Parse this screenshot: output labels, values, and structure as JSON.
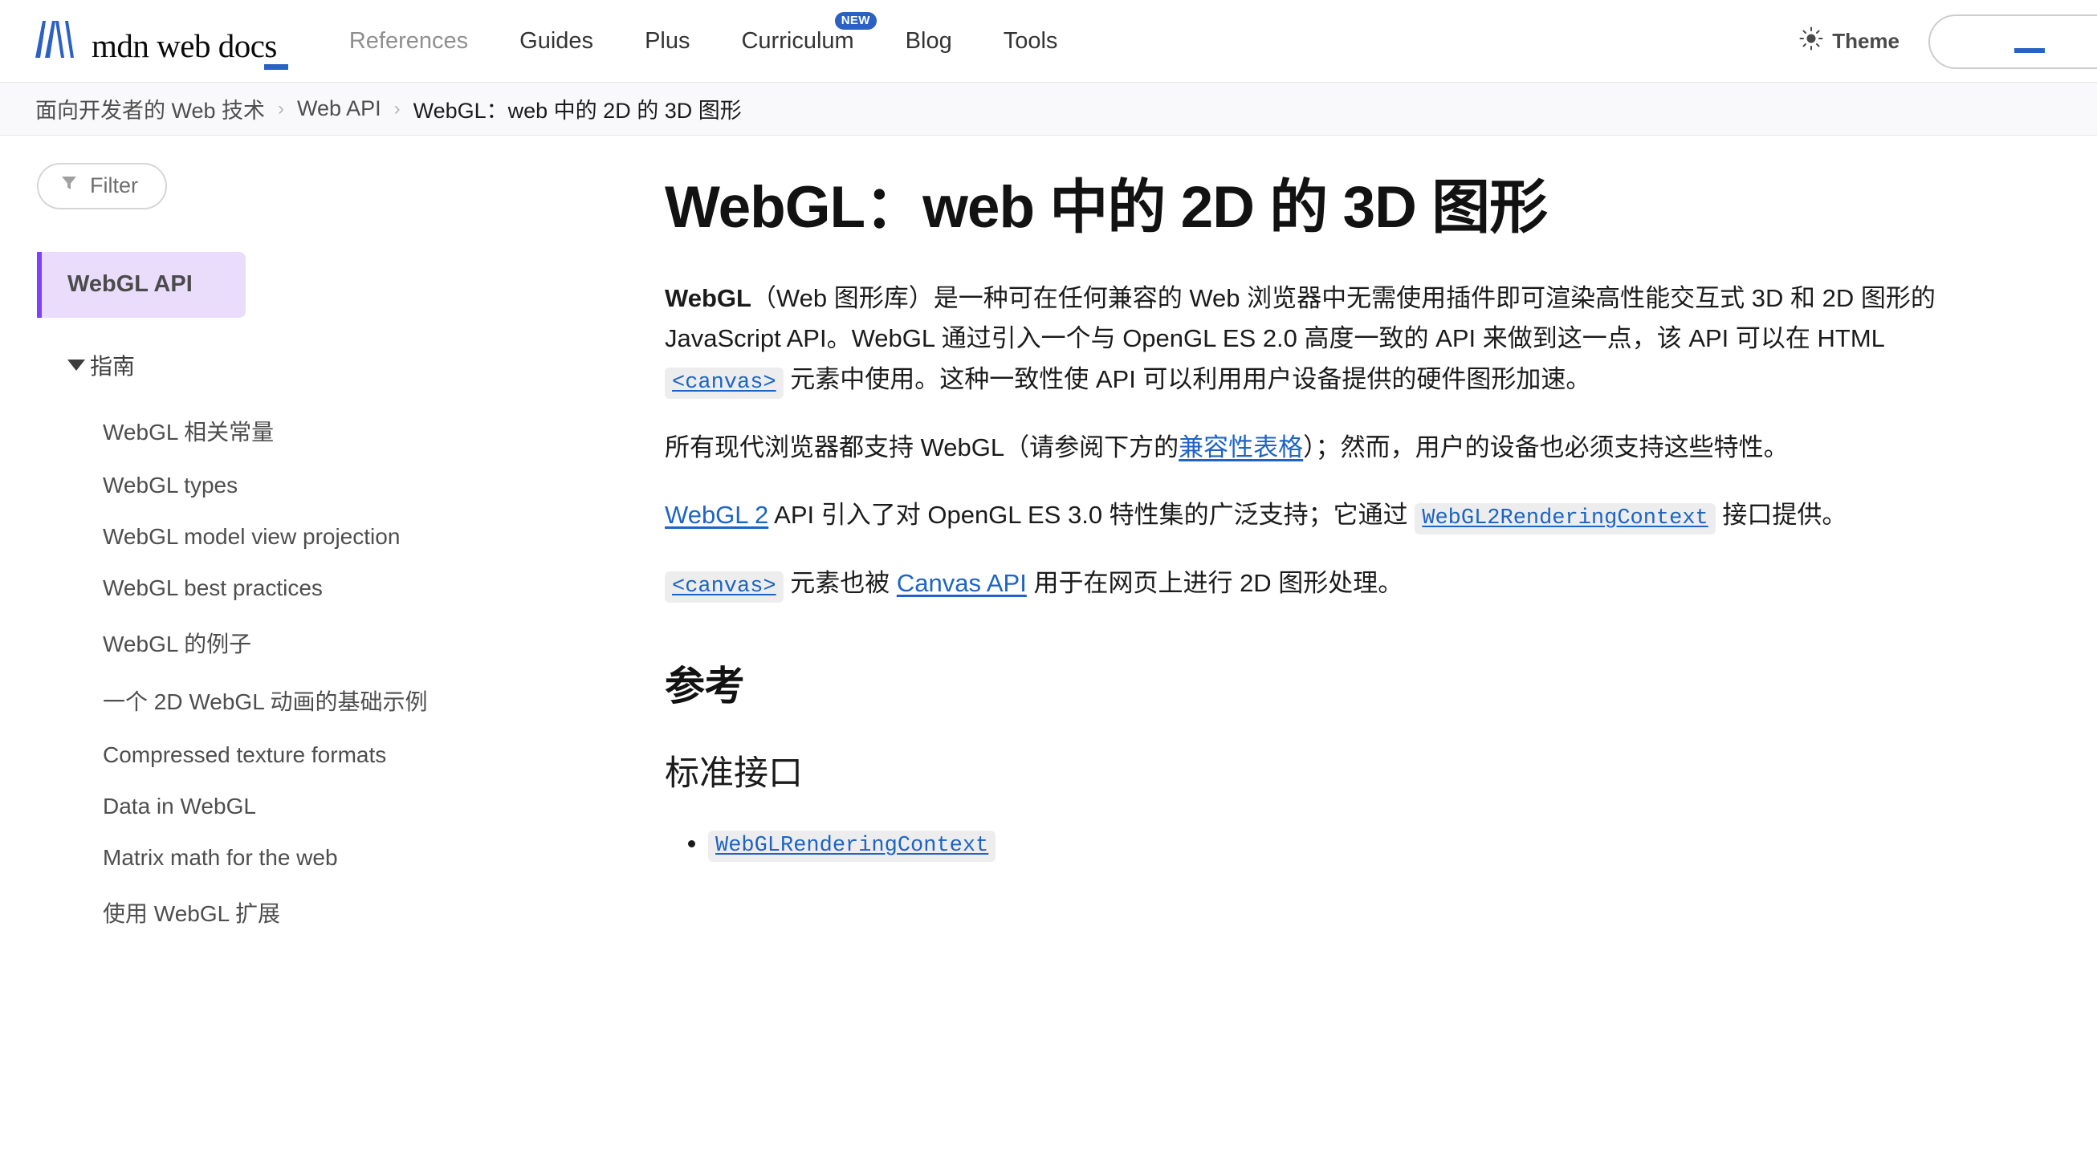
{
  "header": {
    "logo_text": "mdn web docs",
    "logo_icon": "mdn-m-logo",
    "nav": [
      {
        "label": "References",
        "muted": true
      },
      {
        "label": "Guides",
        "muted": false
      },
      {
        "label": "Plus",
        "muted": false
      },
      {
        "label": "Curriculum",
        "muted": false,
        "badge": "NEW"
      },
      {
        "label": "Blog",
        "muted": false
      },
      {
        "label": "Tools",
        "muted": false
      }
    ],
    "theme_label": "Theme",
    "theme_icon": "sun-icon",
    "search_icon": "search-box",
    "accent_blue": "#2b61c4"
  },
  "breadcrumb": {
    "items": [
      "面向开发者的 Web 技术",
      "Web API",
      "WebGL：web 中的 2D 的 3D 图形"
    ],
    "separator": "›"
  },
  "sidebar": {
    "filter_label": "Filter",
    "filter_icon": "funnel-icon",
    "active_item": "WebGL API",
    "active_bg": "#e9ddfb",
    "active_border": "#8040ff",
    "section_label": "指南",
    "items": [
      "WebGL 相关常量",
      "WebGL types",
      "WebGL model view projection",
      "WebGL best practices",
      "WebGL 的例子",
      "一个 2D WebGL 动画的基础示例",
      "Compressed texture formats",
      "Data in WebGL",
      "Matrix math for the web",
      "使用 WebGL 扩展"
    ]
  },
  "main": {
    "title": "WebGL：web 中的 2D 的 3D 图形",
    "p1": {
      "bold_lead": "WebGL",
      "part1": "（Web 图形库）是一种可在任何兼容的 Web 浏览器中无需使用插件即可渲染高性能交互式 3D 和 2D 图形的 JavaScript API。WebGL 通过引入一个与 OpenGL ES 2.0 高度一致的 API 来做到这一点，该 API 可以在 HTML ",
      "code_link": "<canvas>",
      "part2": " 元素中使用。这种一致性使 API 可以利用用户设备提供的硬件图形加速。"
    },
    "p2": {
      "part1": "所有现代浏览器都支持 WebGL（请参阅下方的",
      "link": "兼容性表格",
      "part2": "）；然而，用户的设备也必须支持这些特性。"
    },
    "p3": {
      "link1": "WebGL 2",
      "part1": " API 引入了对 OpenGL ES 3.0 特性集的广泛支持；它通过 ",
      "code_link": "WebGL2RenderingContext",
      "part2": " 接口提供。"
    },
    "p4": {
      "code_link": "<canvas>",
      "part1": " 元素也被 ",
      "link": "Canvas API",
      "part2": " 用于在网页上进行 2D 图形处理。"
    },
    "h2_reference": "参考",
    "h3_standard_interfaces": "标准接口",
    "ref_items": [
      "WebGLRenderingContext"
    ]
  }
}
